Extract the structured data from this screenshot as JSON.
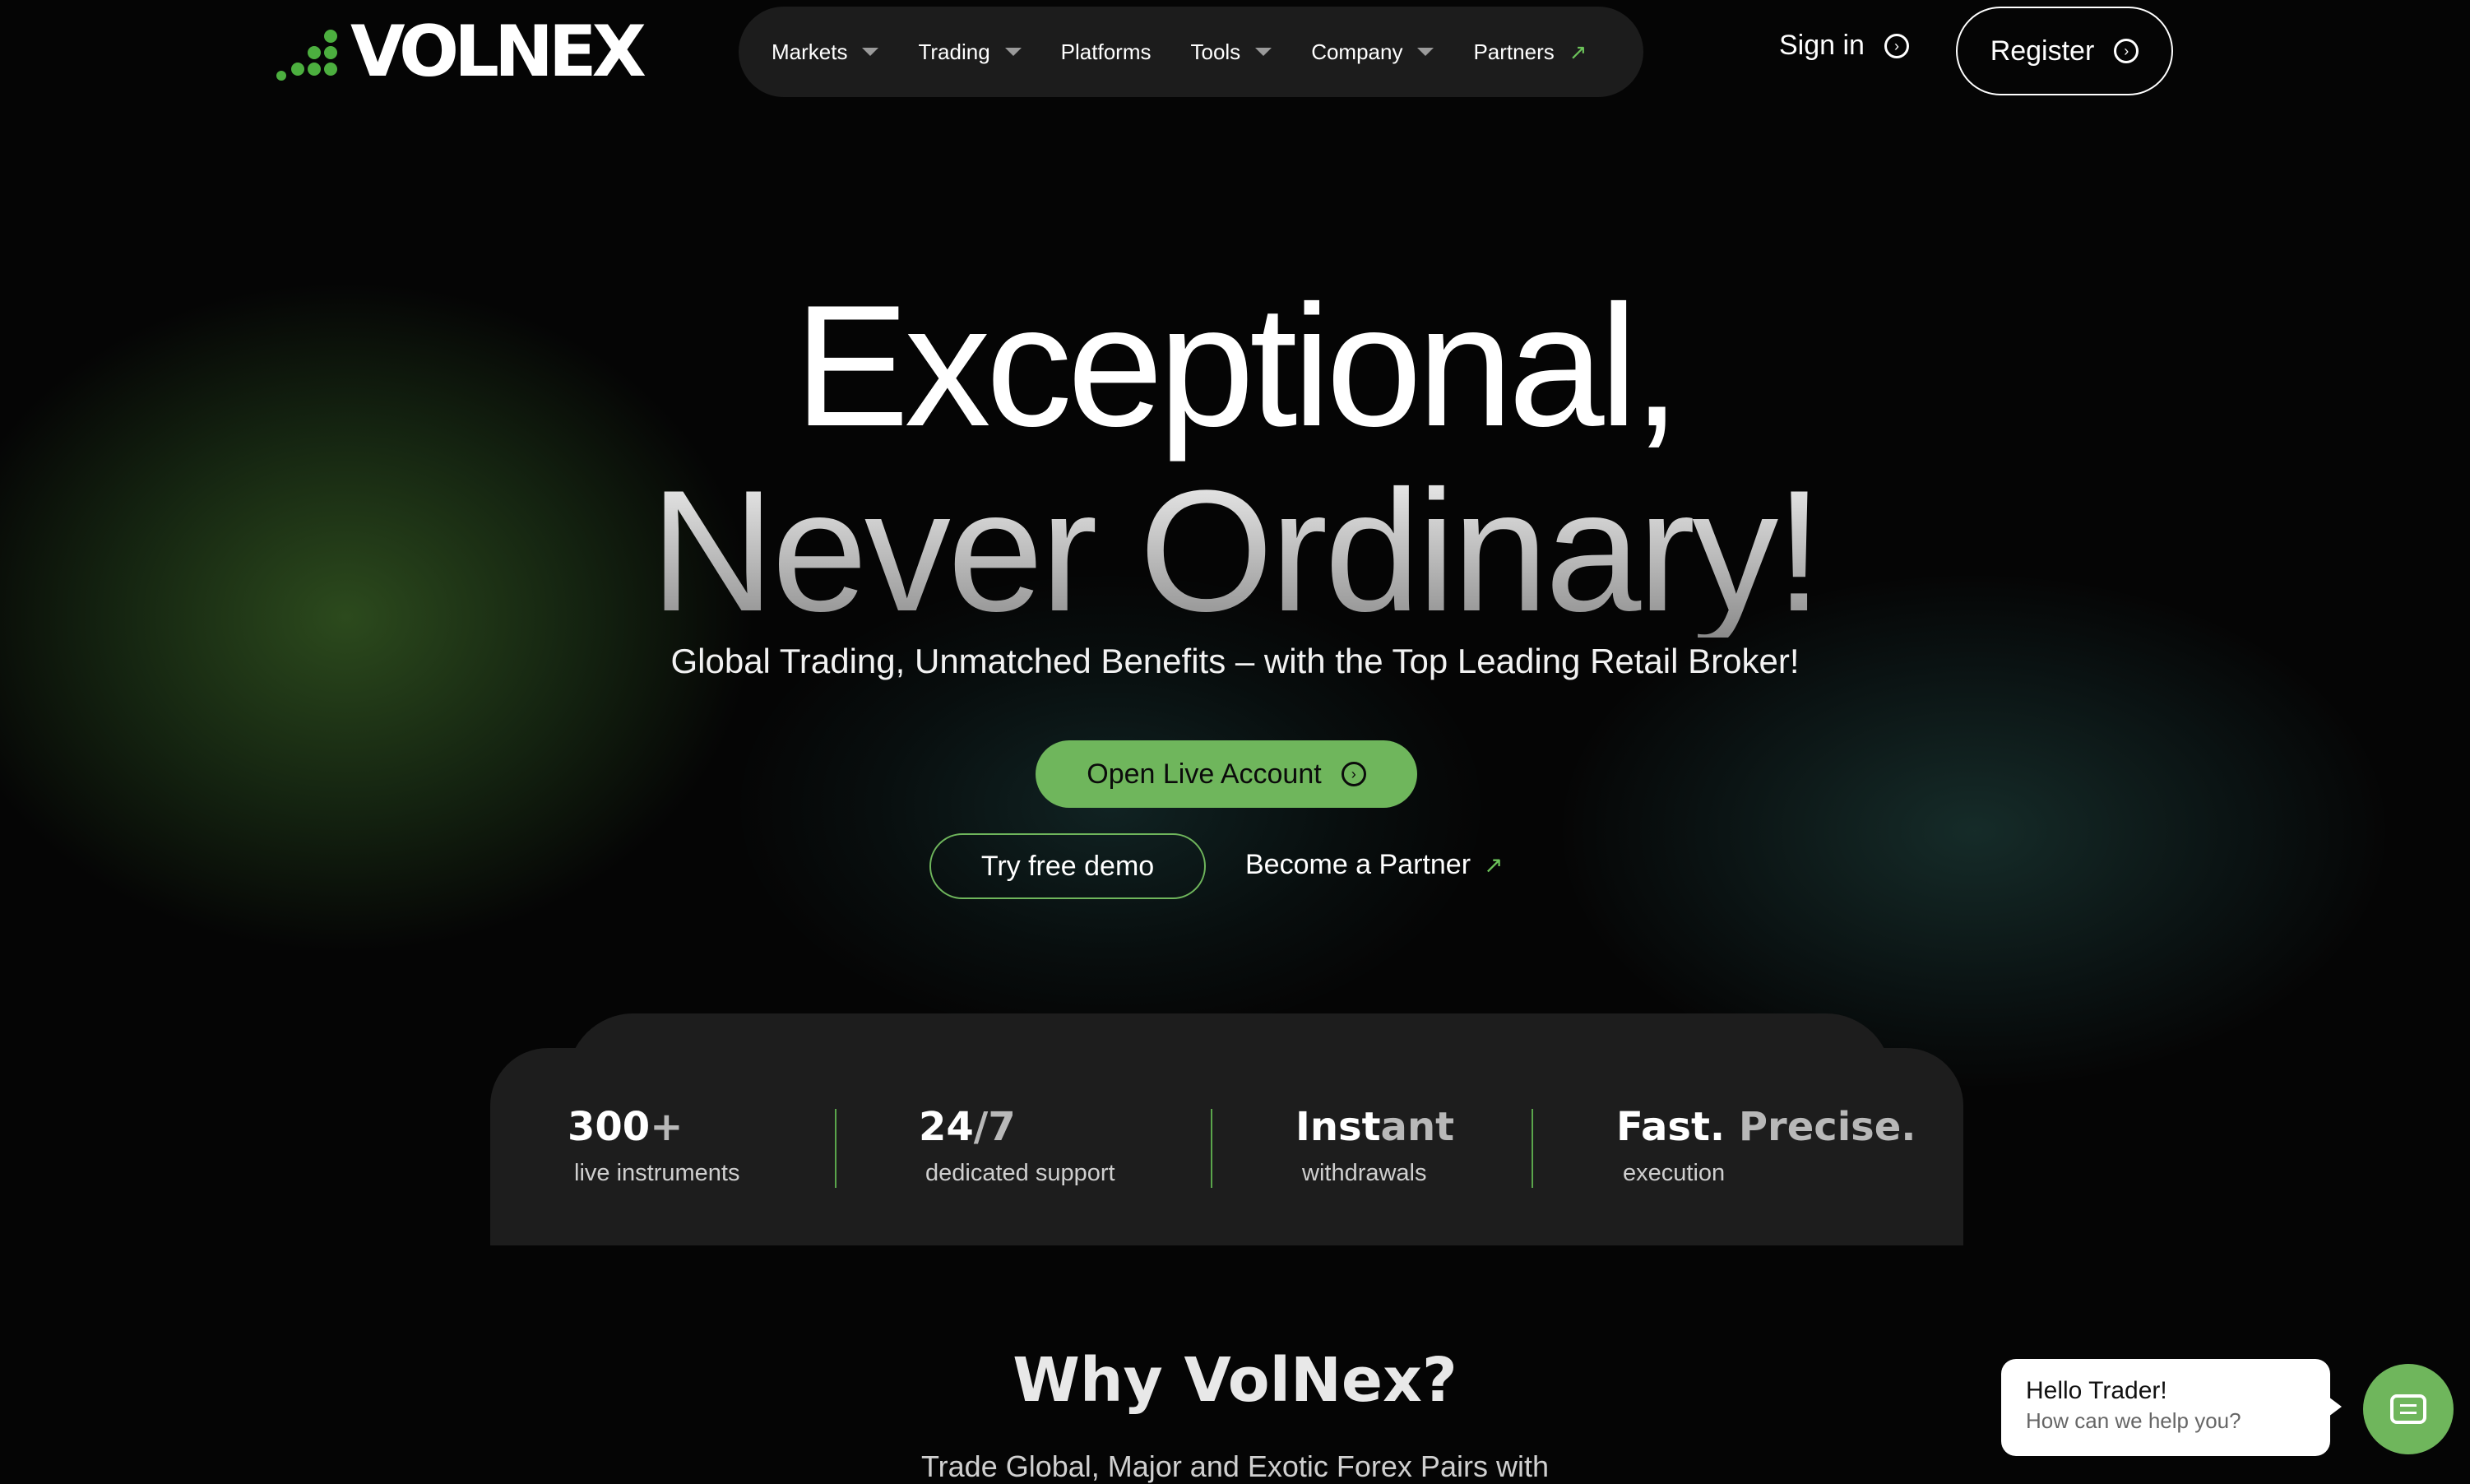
{
  "brand": {
    "name": "VOLNEX",
    "accent_color": "#6fb65c"
  },
  "nav": {
    "items": [
      {
        "label": "Markets",
        "icon": "chevron-down-icon"
      },
      {
        "label": "Trading",
        "icon": "chevron-down-icon"
      },
      {
        "label": "Platforms",
        "icon": ""
      },
      {
        "label": "Tools",
        "icon": "chevron-down-icon"
      },
      {
        "label": "Company",
        "icon": "chevron-down-icon"
      },
      {
        "label": "Partners",
        "icon": "external-arrow-icon"
      }
    ]
  },
  "header": {
    "signin_label": "Sign in",
    "register_label": "Register"
  },
  "hero": {
    "line1": "Exceptional,",
    "line2": "Never Ordinary!",
    "subtitle": "Global Trading, Unmatched Benefits – with the Top Leading Retail Broker!",
    "primary_cta": "Open Live Account",
    "secondary_cta": "Try free demo",
    "partner_link": "Become a Partner"
  },
  "stats": [
    {
      "value": "300",
      "value_dim": "+",
      "label": "live instruments"
    },
    {
      "value": "24",
      "value_dim": "/7",
      "label": "dedicated support"
    },
    {
      "value": "Inst",
      "value_dim": "ant",
      "label": "withdrawals"
    },
    {
      "value": "Fast.",
      "value_dim": " Precise.",
      "label": "execution"
    }
  ],
  "why": {
    "title": "Why VolNex?",
    "partial_line": "Trade Global, Major and Exotic Forex Pairs with"
  },
  "chat": {
    "greeting": "Hello Trader!",
    "prompt": "How can we help you?"
  }
}
